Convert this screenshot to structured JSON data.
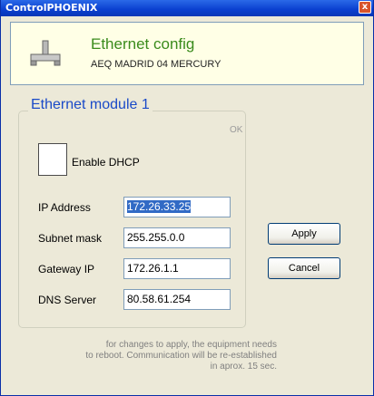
{
  "window": {
    "title": "ControlPHOENIX",
    "close_glyph": "x"
  },
  "banner": {
    "heading": "Ethernet config",
    "device": "AEQ MADRID 04 MERCURY",
    "icon": "network-connector-icon"
  },
  "group": {
    "title": "Ethernet module 1",
    "status": "OK"
  },
  "dhcp": {
    "label": "Enable DHCP",
    "checked": false
  },
  "fields": [
    {
      "label": "IP Address",
      "value": "172.26.33.25",
      "selected": true
    },
    {
      "label": "Subnet mask",
      "value": "255.255.0.0"
    },
    {
      "label": "Gateway IP",
      "value": "172.26.1.1"
    },
    {
      "label": "DNS Server",
      "value": "80.58.61.254"
    }
  ],
  "buttons": {
    "apply": "Apply",
    "cancel": "Cancel"
  },
  "note": {
    "line1": "for changes to apply, the equipment needs",
    "line2": "to reboot. Communication will be re-established",
    "line3": "in aprox. 15 sec."
  },
  "colors": {
    "title_bar": "#0a3fcf",
    "heading_green": "#3a8b1c",
    "group_title_blue": "#1a4ac8",
    "selection": "#316ac5"
  }
}
